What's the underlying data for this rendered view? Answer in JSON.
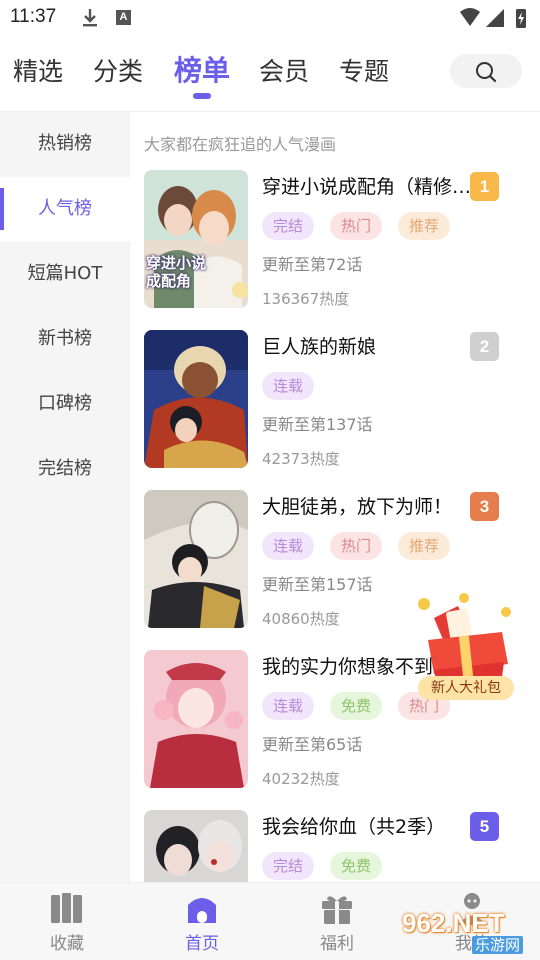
{
  "status_bar": {
    "time": "11:37",
    "notification_letter": "A"
  },
  "top_tabs": [
    {
      "label": "精选",
      "active": false
    },
    {
      "label": "分类",
      "active": false
    },
    {
      "label": "榜单",
      "active": true
    },
    {
      "label": "会员",
      "active": false
    },
    {
      "label": "专题",
      "active": false
    }
  ],
  "sidebar": {
    "items": [
      {
        "label": "热销榜"
      },
      {
        "label": "人气榜"
      },
      {
        "label": "短篇HOT"
      },
      {
        "label": "新书榜"
      },
      {
        "label": "口碑榜"
      },
      {
        "label": "完结榜"
      }
    ],
    "active_index": 1
  },
  "main": {
    "subtitle": "大家都在疯狂追的人气漫画",
    "items": [
      {
        "title": "穿进小说成配角（精修版）",
        "rank": "1",
        "rank_color": "#f9b84a",
        "tags": [
          {
            "label": "完结",
            "style": "purple"
          },
          {
            "label": "热门",
            "style": "red"
          },
          {
            "label": "推荐",
            "style": "orange"
          }
        ],
        "update": "更新至第72话",
        "heat": "136367热度",
        "cover_text": "穿进小说成配角"
      },
      {
        "title": "巨人族的新娘",
        "rank": "2",
        "rank_color": "#cfcfcf",
        "tags": [
          {
            "label": "连载",
            "style": "purple"
          }
        ],
        "update": "更新至第137话",
        "heat": "42373热度"
      },
      {
        "title": "大胆徒弟，放下为师！",
        "rank": "3",
        "rank_color": "#e57e4c",
        "tags": [
          {
            "label": "连载",
            "style": "purple"
          },
          {
            "label": "热门",
            "style": "red"
          },
          {
            "label": "推荐",
            "style": "orange"
          }
        ],
        "update": "更新至第157话",
        "heat": "40860热度"
      },
      {
        "title": "我的实力你想象不到",
        "rank": "4",
        "rank_color": "#6b5ee8",
        "tags": [
          {
            "label": "连载",
            "style": "purple"
          },
          {
            "label": "免费",
            "style": "green"
          },
          {
            "label": "热门",
            "style": "red"
          }
        ],
        "update": "更新至第65话",
        "heat": "40232热度"
      },
      {
        "title": "我会给你血（共2季）",
        "rank": "5",
        "rank_color": "#6b5ee8",
        "tags": [
          {
            "label": "完结",
            "style": "purple"
          },
          {
            "label": "免费",
            "style": "green"
          }
        ],
        "update": "",
        "heat": ""
      }
    ]
  },
  "floating_gift": {
    "label": "新人大礼包",
    "icon": "gift-box-icon"
  },
  "bottom_nav": [
    {
      "label": "收藏",
      "icon": "bookshelf-icon",
      "active": false
    },
    {
      "label": "首页",
      "icon": "home-icon",
      "active": true
    },
    {
      "label": "福利",
      "icon": "gift-icon",
      "active": false
    },
    {
      "label": "我的",
      "icon": "profile-icon",
      "active": false
    }
  ],
  "watermark": {
    "text": "962.NET",
    "subtext": "乐游网"
  },
  "colors": {
    "accent": "#6b5ee8"
  }
}
